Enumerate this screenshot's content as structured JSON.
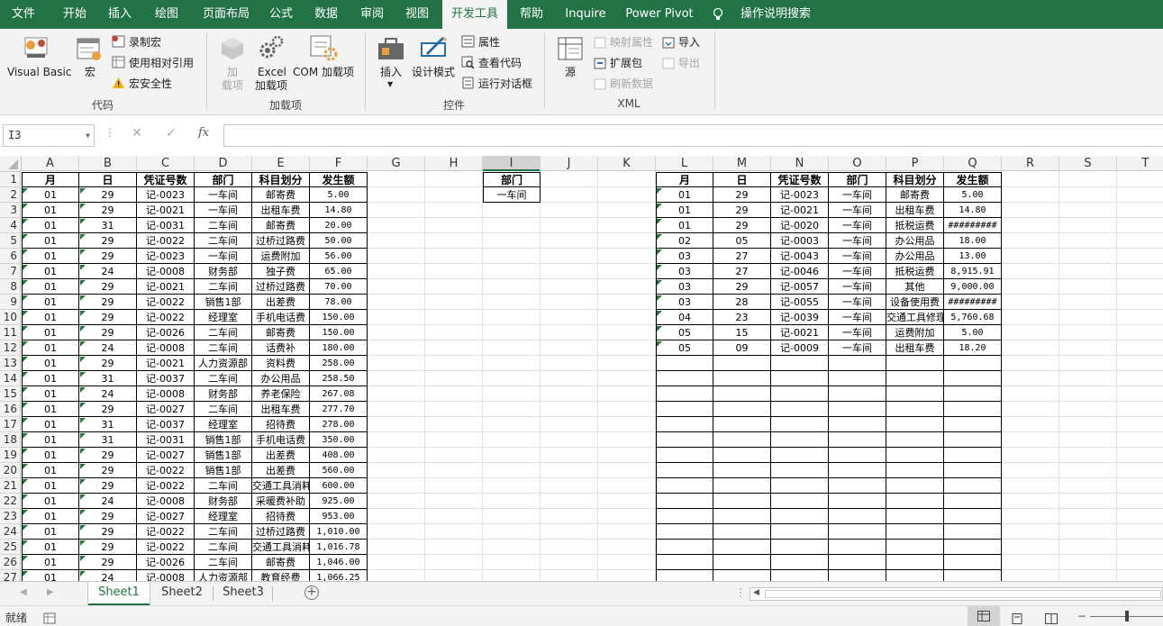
{
  "tabs": [
    "文件",
    "开始",
    "插入",
    "绘图",
    "页面布局",
    "公式",
    "数据",
    "审阅",
    "视图",
    "开发工具",
    "帮助",
    "Inquire",
    "Power Pivot",
    "操作说明搜索"
  ],
  "ribbon": {
    "code": {
      "vb": "Visual Basic",
      "macro": "宏",
      "record": "录制宏",
      "relative": "使用相对引用",
      "security": "宏安全性",
      "group": "代码"
    },
    "addins": {
      "addin1": "加",
      "addin2": "载项",
      "excel1": "Excel",
      "excel2": "加载项",
      "com": "COM 加载项",
      "group": "加载项"
    },
    "controls": {
      "insert": "插入",
      "design": "设计模式",
      "props": "属性",
      "viewcode": "查看代码",
      "dialog": "运行对话框",
      "group": "控件"
    },
    "xml": {
      "source": "源",
      "map": "映射属性",
      "expand": "扩展包",
      "refresh": "刷新数据",
      "import": "导入",
      "export": "导出",
      "group": "XML"
    }
  },
  "formula": {
    "namebox": "I3",
    "cancel": "✕",
    "confirm": "✓",
    "fx": "fx",
    "value": ""
  },
  "columns": [
    "A",
    "B",
    "C",
    "D",
    "E",
    "F",
    "G",
    "H",
    "I",
    "J",
    "K",
    "L",
    "M",
    "N",
    "O",
    "P",
    "Q",
    "R",
    "S",
    "T"
  ],
  "rows": [
    "1",
    "2",
    "3",
    "4",
    "5",
    "6",
    "7",
    "8",
    "9",
    "10",
    "11",
    "12",
    "13",
    "14",
    "15",
    "16",
    "17",
    "18",
    "19",
    "20",
    "21",
    "22",
    "23",
    "24",
    "25",
    "26",
    "27"
  ],
  "left_headers": [
    "月",
    "日",
    "凭证号数",
    "部门",
    "科目划分",
    "发生额"
  ],
  "left_table": [
    [
      "01",
      "29",
      "记-0023",
      "一车间",
      "邮寄费",
      "5.00"
    ],
    [
      "01",
      "29",
      "记-0021",
      "一车间",
      "出租车费",
      "14.80"
    ],
    [
      "01",
      "31",
      "记-0031",
      "二车间",
      "邮寄费",
      "20.00"
    ],
    [
      "01",
      "29",
      "记-0022",
      "二车间",
      "过桥过路费",
      "50.00"
    ],
    [
      "01",
      "29",
      "记-0023",
      "一车间",
      "运费附加",
      "56.00"
    ],
    [
      "01",
      "24",
      "记-0008",
      "财务部",
      "独子费",
      "65.00"
    ],
    [
      "01",
      "29",
      "记-0021",
      "二车间",
      "过桥过路费",
      "70.00"
    ],
    [
      "01",
      "29",
      "记-0022",
      "销售1部",
      "出差费",
      "78.00"
    ],
    [
      "01",
      "29",
      "记-0022",
      "经理室",
      "手机电话费",
      "150.00"
    ],
    [
      "01",
      "29",
      "记-0026",
      "二车间",
      "邮寄费",
      "150.00"
    ],
    [
      "01",
      "24",
      "记-0008",
      "二车间",
      "话费补",
      "180.00"
    ],
    [
      "01",
      "29",
      "记-0021",
      "人力资源部",
      "资料费",
      "258.00"
    ],
    [
      "01",
      "31",
      "记-0037",
      "二车间",
      "办公用品",
      "258.50"
    ],
    [
      "01",
      "24",
      "记-0008",
      "财务部",
      "养老保险",
      "267.08"
    ],
    [
      "01",
      "29",
      "记-0027",
      "二车间",
      "出租车费",
      "277.70"
    ],
    [
      "01",
      "31",
      "记-0037",
      "经理室",
      "招待费",
      "278.00"
    ],
    [
      "01",
      "31",
      "记-0031",
      "销售1部",
      "手机电话费",
      "350.00"
    ],
    [
      "01",
      "29",
      "记-0027",
      "销售1部",
      "出差费",
      "408.00"
    ],
    [
      "01",
      "29",
      "记-0022",
      "销售1部",
      "出差费",
      "560.00"
    ],
    [
      "01",
      "29",
      "记-0022",
      "二车间",
      "交通工具消耗",
      "600.00"
    ],
    [
      "01",
      "24",
      "记-0008",
      "财务部",
      "采暖费补助",
      "925.00"
    ],
    [
      "01",
      "29",
      "记-0027",
      "经理室",
      "招待费",
      "953.00"
    ],
    [
      "01",
      "29",
      "记-0022",
      "二车间",
      "过桥过路费",
      "1,010.00"
    ],
    [
      "01",
      "29",
      "记-0022",
      "二车间",
      "交通工具消耗",
      "1,016.78"
    ],
    [
      "01",
      "29",
      "记-0026",
      "二车间",
      "邮寄费",
      "1,046.00"
    ],
    [
      "01",
      "24",
      "记-0008",
      "人力资源部",
      "教育经费",
      "1,066.25"
    ]
  ],
  "criteria": {
    "header": "部门",
    "value": "一车间"
  },
  "right_table": [
    [
      "01",
      "29",
      "记-0023",
      "一车间",
      "邮寄费",
      "5.00"
    ],
    [
      "01",
      "29",
      "记-0021",
      "一车间",
      "出租车费",
      "14.80"
    ],
    [
      "01",
      "29",
      "记-0020",
      "一车间",
      "抵税运费",
      "#########"
    ],
    [
      "02",
      "05",
      "记-0003",
      "一车间",
      "办公用品",
      "18.00"
    ],
    [
      "03",
      "27",
      "记-0043",
      "一车间",
      "办公用品",
      "13.00"
    ],
    [
      "03",
      "27",
      "记-0046",
      "一车间",
      "抵税运费",
      "8,915.91"
    ],
    [
      "03",
      "29",
      "记-0057",
      "一车间",
      "其他",
      "9,000.00"
    ],
    [
      "03",
      "28",
      "记-0055",
      "一车间",
      "设备使用费",
      "#########"
    ],
    [
      "04",
      "23",
      "记-0039",
      "一车间",
      "交通工具修理",
      "5,760.68"
    ],
    [
      "05",
      "15",
      "记-0021",
      "一车间",
      "运费附加",
      "5.00"
    ],
    [
      "05",
      "09",
      "记-0009",
      "一车间",
      "出租车费",
      "18.20"
    ]
  ],
  "sheets": [
    "Sheet1",
    "Sheet2",
    "Sheet3"
  ],
  "status": "就绪"
}
